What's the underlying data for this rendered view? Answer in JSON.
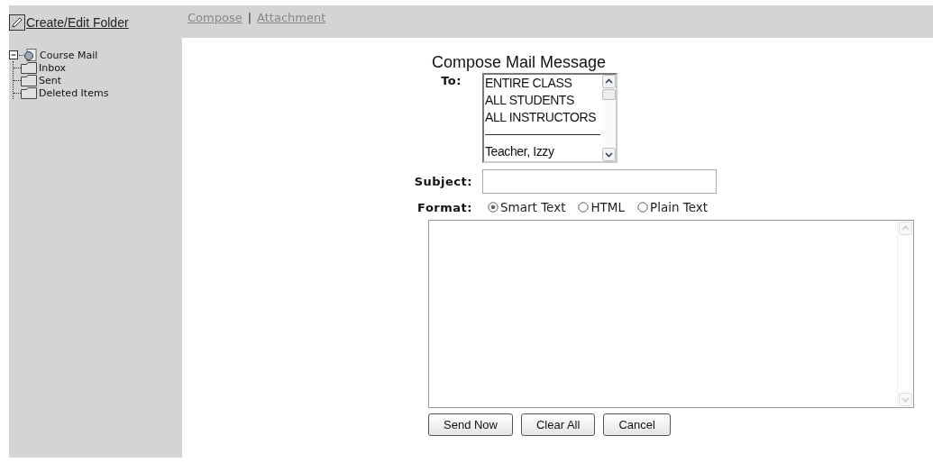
{
  "sidebar": {
    "create_link": "Create/Edit Folder",
    "tree": [
      {
        "label": "Course Mail",
        "kind": "root",
        "expanded": true,
        "children": [
          {
            "label": "Inbox",
            "kind": "folder"
          },
          {
            "label": "Sent",
            "kind": "folder"
          },
          {
            "label": "Deleted Items",
            "kind": "folder"
          }
        ]
      }
    ]
  },
  "nav": {
    "links": [
      "Compose",
      "Attachment"
    ],
    "separator": "|"
  },
  "form": {
    "title": "Compose Mail Message",
    "to": {
      "label": "To:",
      "recipients": [
        {
          "kind": "text",
          "label": "ENTIRE CLASS"
        },
        {
          "kind": "text",
          "label": "ALL STUDENTS"
        },
        {
          "kind": "text",
          "label": "ALL INSTRUCTORS"
        },
        {
          "kind": "separator"
        },
        {
          "kind": "text",
          "label": "Teacher, Izzy"
        }
      ]
    },
    "subject": {
      "label": "Subject:"
    },
    "format": {
      "label": "Format:",
      "options": [
        {
          "label": "Smart Text",
          "selected": true
        },
        {
          "label": "HTML",
          "selected": false
        },
        {
          "label": "Plain Text",
          "selected": false
        }
      ]
    },
    "buttons": [
      "Send Now",
      "Clear All",
      "Cancel"
    ]
  }
}
